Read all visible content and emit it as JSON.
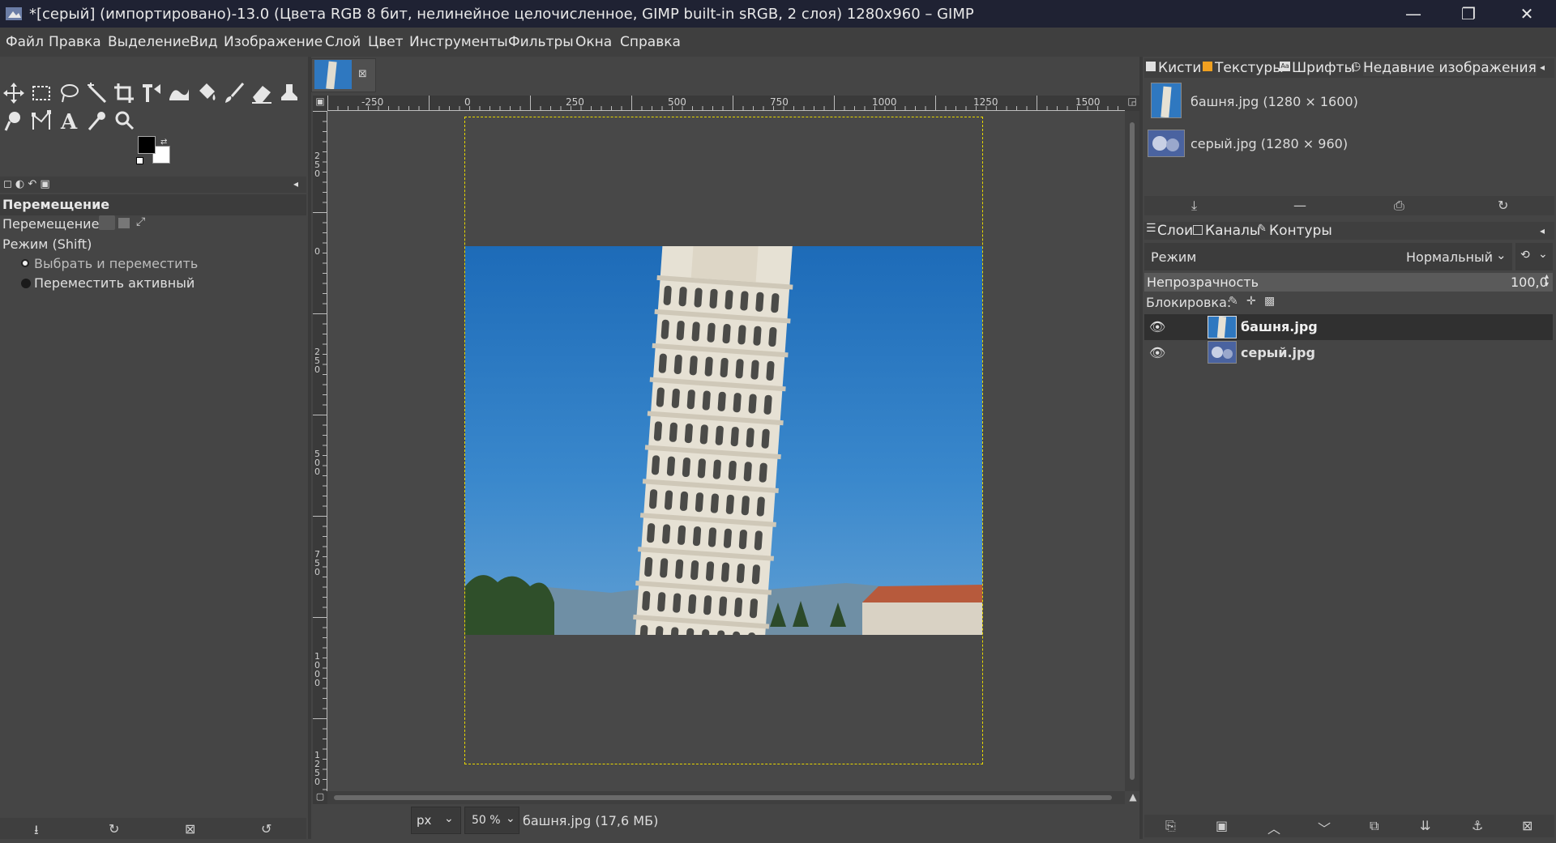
{
  "window": {
    "title": "*[серый] (импортировано)-13.0 (Цвета RGB 8 бит, нелинейное целочисленное, GIMP built-in sRGB, 2 слоя) 1280x960 – GIMP",
    "minimize": "—",
    "maximize": "❐",
    "close": "✕"
  },
  "menu": [
    "Файл",
    "Правка",
    "Выделение",
    "Вид",
    "Изображение",
    "Слой",
    "Цвет",
    "Инструменты",
    "Фильтры",
    "Окна",
    "Справка"
  ],
  "tool_options": {
    "title": "Перемещение",
    "move_label": "Перемещение:",
    "mode_label": "Режим (Shift)",
    "option1": "Выбрать и переместить",
    "option2": "Переместить активный"
  },
  "ruler": {
    "h_ticks": [
      "-250",
      "0",
      "250",
      "500",
      "750",
      "1000",
      "1250",
      "1500"
    ],
    "v_ticks": [
      "250",
      "0",
      "250",
      "500",
      "750",
      "1000",
      "1250"
    ]
  },
  "statusbar": {
    "unit": "px",
    "zoom": "50 %",
    "info": "башня.jpg (17,6 МБ)"
  },
  "dock_top": {
    "tabs": [
      "Кисти",
      "Текстуры",
      "Шрифты",
      "Недавние изображения"
    ],
    "recent": [
      {
        "label": "башня.jpg (1280 × 1600)"
      },
      {
        "label": "серый.jpg (1280 × 960)"
      }
    ]
  },
  "layers": {
    "tabs": [
      "Слои",
      "Каналы",
      "Контуры"
    ],
    "mode_label": "Режим",
    "mode_value": "Нормальный",
    "opacity_label": "Непрозрачность",
    "opacity_value": "100,0",
    "lock_label": "Блокировка:",
    "items": [
      {
        "name": "башня.jpg"
      },
      {
        "name": "серый.jpg"
      }
    ]
  },
  "colors": {
    "titlebar": "#1f2233",
    "sky": "#2f78c0",
    "selection": "#e8d800"
  }
}
